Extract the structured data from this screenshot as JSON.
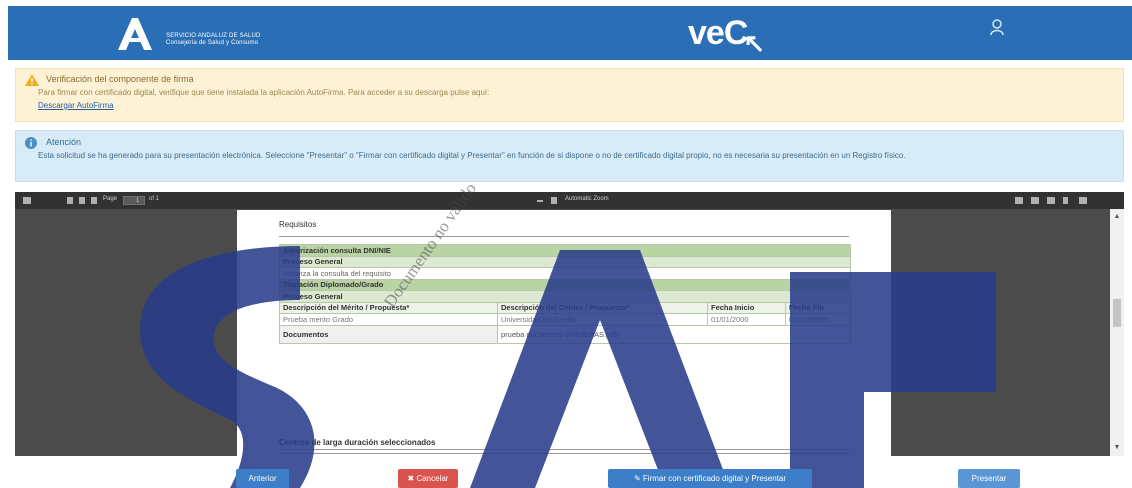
{
  "header": {
    "org_line1": "SERVICIO ANDALUZ DE SALUD",
    "org_line2": "Consejería de Salud y Consumo",
    "app_logo": "veC",
    "user_name": ""
  },
  "warning": {
    "title": "Verificación del componente de firma",
    "body": "Para firmar con certificado digital, verifique que tiene instalada la aplicación AutoFirma. Para acceder a su descarga pulse aquí:",
    "link": "Descargar AutoFirma",
    "icon": "warning-icon"
  },
  "info": {
    "title": "Atención",
    "body": "Esta solicitud se ha generado para su presentación electrónica. Seleccione \"Presentar\" o \"Firmar con certificado digital y Presentar\" en función de si dispone o no de certificado digital propio, no es necesaria su presentación en un Registro físico.",
    "icon": "info-icon"
  },
  "viewer": {
    "page_label": "Page",
    "page_number": "1",
    "page_of": "of 1",
    "zoom": "Automatic Zoom"
  },
  "document": {
    "requisitos_heading": "Requisitos",
    "auth_section": "Autorización consulta DNI/NIE",
    "proceso_general_1": "Proceso General",
    "auth_text": "Autoriza la consulta del requisito",
    "titulacion_section": "Titulación Diplomado/Grado",
    "proceso_general_2": "Proceso General",
    "columns": [
      "Descripción del Mérito / Propuesta*",
      "Descripción del Centro / Propuesta*",
      "Fecha Inicio",
      "Fecha Fin"
    ],
    "row": [
      "Prueba merito Grado",
      "Universidad de Sevilla",
      "01/01/2000",
      "01/01/2000"
    ],
    "documentos_label": "Documentos",
    "documentos_value": "prueba documento (PRUEBAS.pdf)",
    "centros_heading": "Centros de larga duración seleccionados",
    "watermark": "Documento no válido"
  },
  "buttons": {
    "back": "Anterior",
    "cancel": "Cancelar",
    "sign": "Firmar con certificado digital y Presentar",
    "present": "Presentar"
  },
  "colors": {
    "header": "#2a6fb5",
    "warning_bg": "#fdf1d6",
    "info_bg": "#d8ecf7",
    "cancel": "#d9534f",
    "primary": "#3c7ec7"
  }
}
